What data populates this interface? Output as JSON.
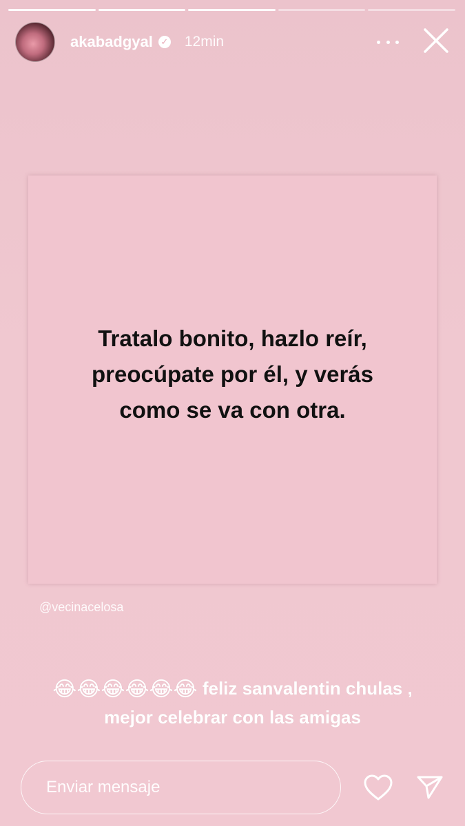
{
  "story": {
    "segments_total": 5,
    "segments_done": 3
  },
  "header": {
    "username": "akabadgyal",
    "time": "12min",
    "avatar_icon": "avatar",
    "verified_icon": "verified-badge-icon",
    "more_icon": "more-options-icon",
    "close_icon": "close-icon"
  },
  "post": {
    "text": "Tratalo bonito, hazlo reír, preocúpate por él, y verás como se va con otra.",
    "credit": "@vecinacelosa"
  },
  "caption": {
    "emojis": "😂😂😂😂😂😂",
    "text": " feliz sanvalentin chulas , mejor celebrar con las amigas"
  },
  "footer": {
    "message_placeholder": "Enviar mensaje",
    "like_icon": "heart-icon",
    "send_icon": "send-icon"
  },
  "colors": {
    "background": "#f1c8d1",
    "text_dark": "#111111",
    "text_light": "#ffffff"
  }
}
